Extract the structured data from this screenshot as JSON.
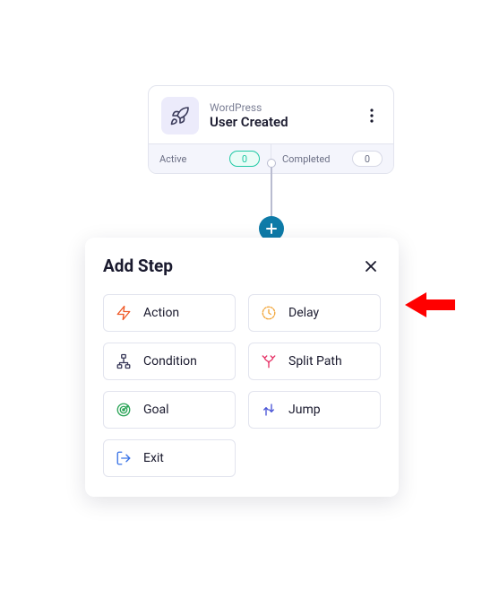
{
  "trigger": {
    "source": "WordPress",
    "title": "User Created",
    "stats": {
      "active_label": "Active",
      "active_count": "0",
      "completed_label": "Completed",
      "completed_count": "0"
    }
  },
  "popup": {
    "title": "Add Step",
    "options": {
      "action": "Action",
      "delay": "Delay",
      "condition": "Condition",
      "split_path": "Split Path",
      "goal": "Goal",
      "jump": "Jump",
      "exit": "Exit"
    }
  }
}
